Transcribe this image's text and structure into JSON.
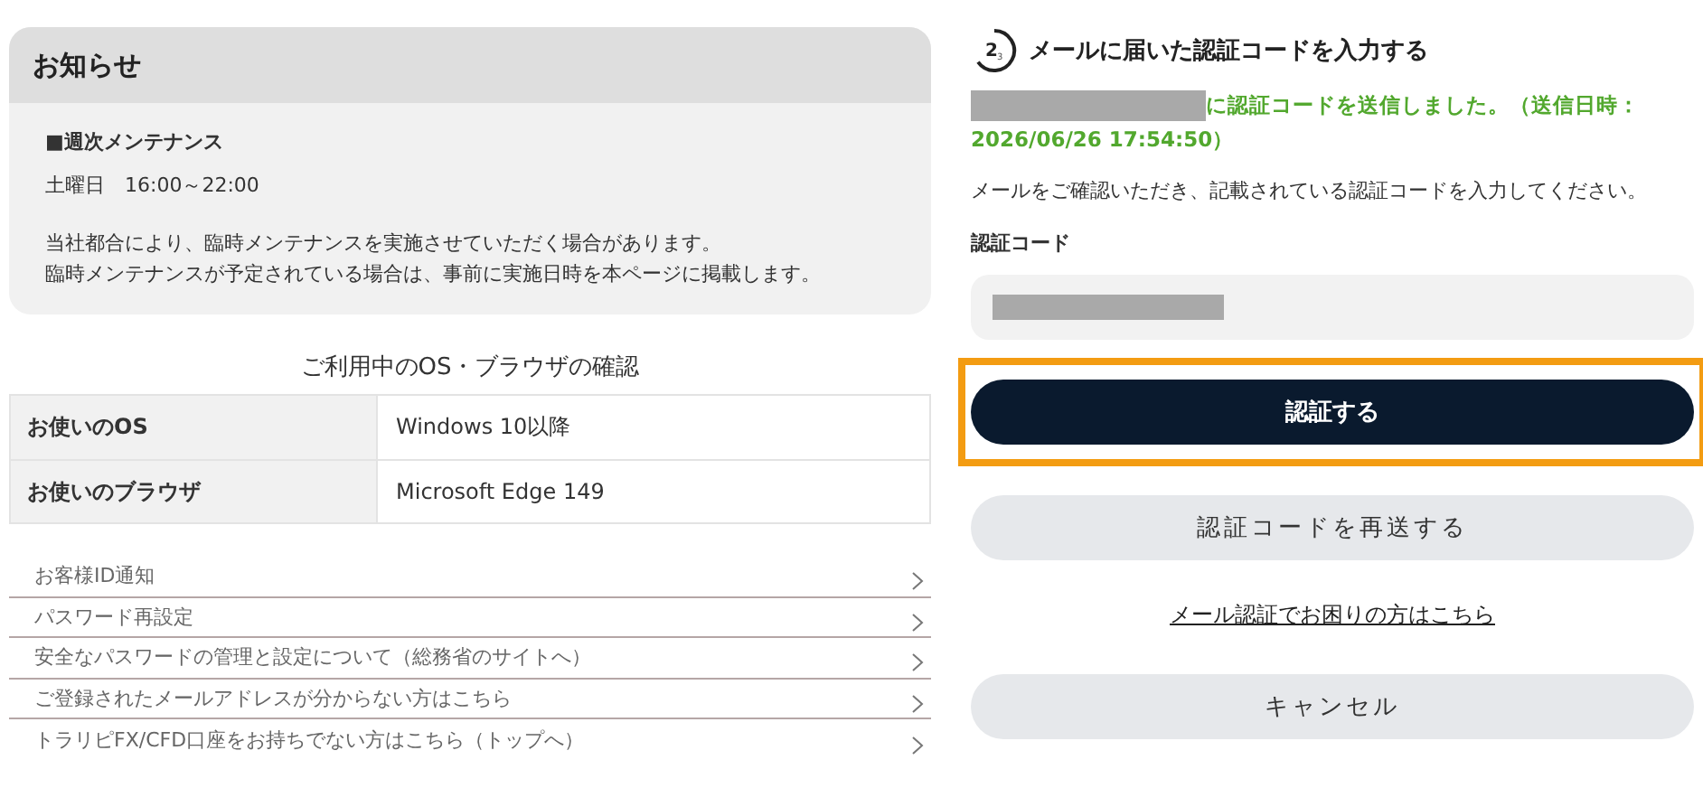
{
  "notice": {
    "title": "お知らせ",
    "heading": "■週次メンテナンス",
    "schedule": "土曜日　16:00～22:00",
    "lines": [
      "当社都合により、臨時メンテナンスを実施させていただく場合があります。",
      "臨時メンテナンスが予定されている場合は、事前に実施日時を本ページに掲載します。"
    ]
  },
  "environment": {
    "title": "ご利用中のOS・ブラウザの確認",
    "rows": [
      {
        "label": "お使いのOS",
        "value": "Windows 10以降"
      },
      {
        "label": "お使いのブラウザ",
        "value": "Microsoft Edge 149"
      }
    ]
  },
  "links": [
    "お客様ID通知",
    "パスワード再設定",
    "安全なパスワードの管理と設定について（総務省のサイトへ）",
    "ご登録されたメールアドレスが分からない方はこちら",
    "トラリピFX/CFD口座をお持ちでない方はこちら（トップへ）"
  ],
  "verification": {
    "step": "2",
    "step_total": "3",
    "title": "メールに届いた認証コードを入力する",
    "sent_message": "に認証コードを送信しました。（送信日時：2026/06/26 17:54:50）",
    "instruction": "メールをご確認いただき、記載されている認証コードを入力してください。",
    "field_label": "認証コード",
    "submit": {
      "label": "認証する",
      "highlighted": true
    },
    "resend": "認証コードを再送する",
    "help_link": "メール認証でお困りの方はこちら",
    "cancel": "キャンセル"
  }
}
